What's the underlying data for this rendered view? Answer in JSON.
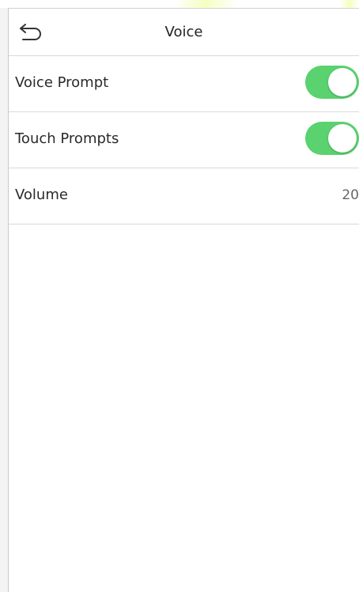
{
  "header": {
    "title": "Voice",
    "back_icon": "back-arrow-icon"
  },
  "settings": [
    {
      "label": "Voice Prompt",
      "type": "toggle",
      "enabled": true
    },
    {
      "label": "Touch Prompts",
      "type": "toggle",
      "enabled": true
    },
    {
      "label": "Volume",
      "type": "value",
      "value": "20"
    }
  ],
  "colors": {
    "toggle_on": "#59d26f",
    "divider": "#d9d9d9",
    "background": "#ffffff"
  }
}
